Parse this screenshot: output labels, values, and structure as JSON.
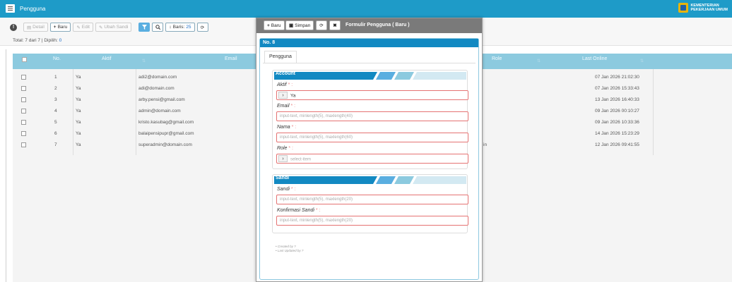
{
  "app": {
    "title": "Pengguna",
    "logo_line1": "KEMENTERIAN",
    "logo_line2": "PEKERJAAN UMUM"
  },
  "toolbar": {
    "detail_label": "Detail",
    "new_label": "Baru",
    "edit_label": "Edit",
    "change_password_label": "Ubah Sandi",
    "rows_label": "Baris:",
    "rows_value": "25",
    "total_label": "Total: 7 dari 7 | Dipilih:",
    "selected_count": "0"
  },
  "table": {
    "headers": {
      "no": "No.",
      "aktif": "Aktif",
      "email": "Email",
      "role": "Role",
      "last_online": "Last Online"
    },
    "rows": [
      {
        "no": "1",
        "aktif": "Ya",
        "email": "adi2@domain.com",
        "role": "",
        "last_online": "07 Jan 2026 21:02:30"
      },
      {
        "no": "2",
        "aktif": "Ya",
        "email": "adi@domain.com",
        "role": "",
        "last_online": "07 Jan 2026 15:33:43"
      },
      {
        "no": "3",
        "aktif": "Ya",
        "email": "arby.pensi@gmail.com",
        "role": "",
        "last_online": "13 Jan 2026 16:40:33"
      },
      {
        "no": "4",
        "aktif": "Ya",
        "email": "admin@domain.com",
        "role": "",
        "last_online": "09 Jan 2026 00:10:27"
      },
      {
        "no": "5",
        "aktif": "Ya",
        "email": "kristo.kasubag@gmail.com",
        "role": "",
        "last_online": "09 Jan 2026 10:33:36"
      },
      {
        "no": "6",
        "aktif": "Ya",
        "email": "balaipensipupr@gmail.com",
        "role": "",
        "last_online": "14 Jan 2026 15:23:29"
      },
      {
        "no": "7",
        "aktif": "Ya",
        "email": "superadmin@domain.com",
        "role": "in",
        "last_online": "12 Jan 2026 09:41:55"
      }
    ]
  },
  "dialog": {
    "new_label": "Baru",
    "save_label": "Simpan",
    "title": "Formulir Pengguna ( Baru )",
    "record_no": "No. 8",
    "tab_label": "Pengguna",
    "account_section": "Account",
    "aktif_label": "Aktif",
    "aktif_value": "Ya",
    "email_label": "Email",
    "email_placeholder": "input-text, minlength(5), maxlength(40)",
    "nama_label": "Nama",
    "nama_placeholder": "input-text, minlength(5), maxlength(60)",
    "role_label": "Role",
    "role_placeholder": "select-item",
    "sandi_section": "Sandi",
    "sandi_label": "Sandi",
    "sandi_placeholder": "input-text, minlength(5), maxlength(20)",
    "konfirmasi_label": "Konfirmasi Sandi",
    "konfirmasi_placeholder": "input-text, minlength(5), maxlength(20)",
    "required_mark": "* :",
    "created_by": "Created by ?",
    "updated_by": "Last Updated by ?"
  },
  "colors": {
    "header_blue": "#1e9bc8",
    "table_header": "#8ccadf",
    "dialog_head": "#1289c2",
    "error_border": "#e57373"
  }
}
